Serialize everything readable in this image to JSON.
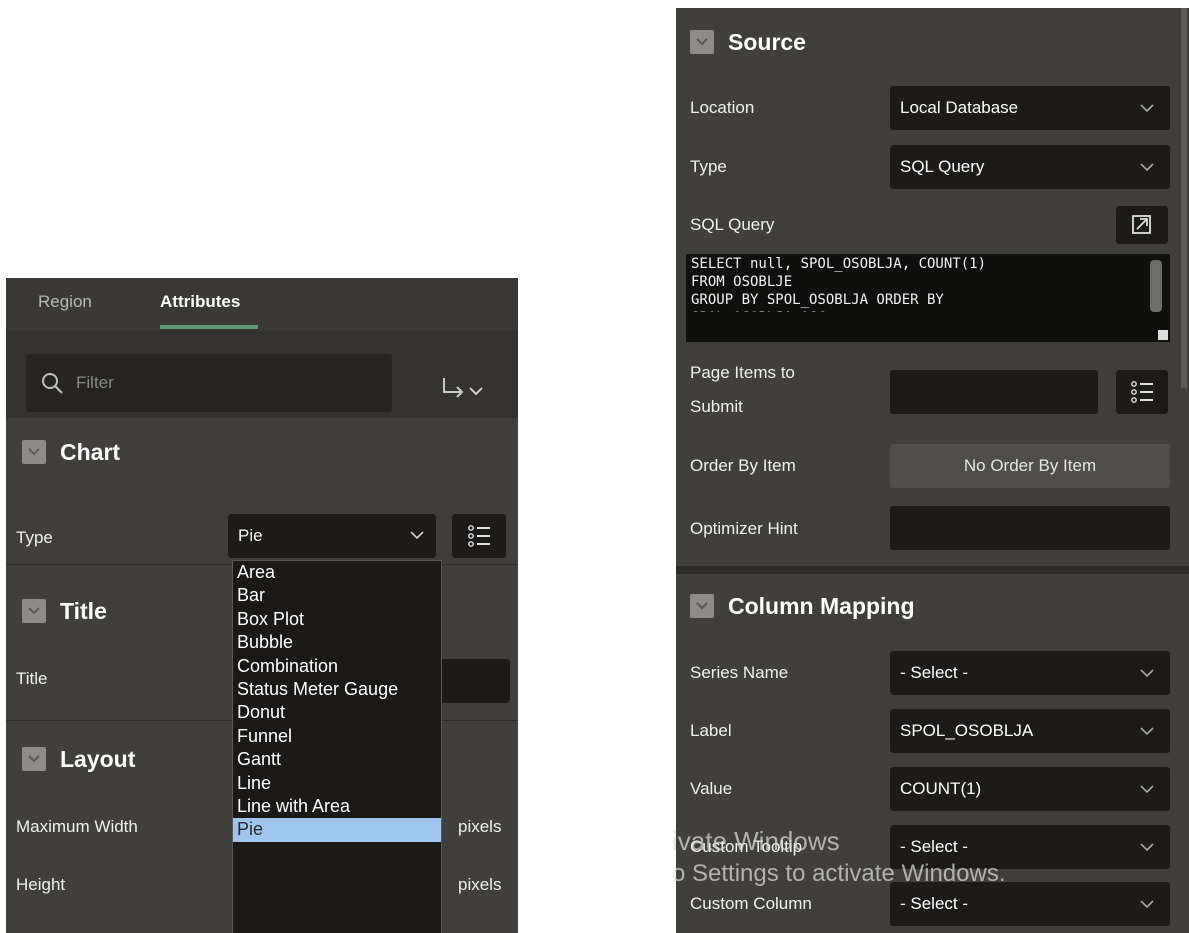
{
  "left_panel": {
    "tabs": {
      "region": "Region",
      "attributes": "Attributes"
    },
    "filter": {
      "placeholder": "Filter"
    },
    "chart": {
      "heading": "Chart",
      "type_label": "Type",
      "type_value": "Pie",
      "type_options": [
        "Area",
        "Bar",
        "Box Plot",
        "Bubble",
        "Combination",
        "Status Meter Gauge",
        "Donut",
        "Funnel",
        "Gantt",
        "Line",
        "Line with Area",
        "Pie"
      ]
    },
    "title_section": {
      "heading": "Title",
      "title_label": "Title"
    },
    "layout": {
      "heading": "Layout",
      "max_width_label": "Maximum Width",
      "height_label": "Height",
      "unit": "pixels"
    }
  },
  "right_panel": {
    "source": {
      "heading": "Source",
      "location_label": "Location",
      "location_value": "Local Database",
      "type_label": "Type",
      "type_value": "SQL Query",
      "sql_query_label": "SQL Query",
      "sql_lines": [
        "SELECT null, SPOL_OSOBLJA, COUNT(1)",
        "FROM OSOBLJE",
        "GROUP BY SPOL_OSOBLJA ORDER BY",
        "SPOL_OSOBLJA ASC"
      ],
      "page_items_label_1": "Page Items to",
      "page_items_label_2": "Submit",
      "order_by_label": "Order By Item",
      "order_by_value": "No Order By Item",
      "optimizer_label": "Optimizer Hint"
    },
    "column_mapping": {
      "heading": "Column Mapping",
      "series_name_label": "Series Name",
      "series_name_value": "- Select -",
      "label_label": "Label",
      "label_value": "SPOL_OSOBLJA",
      "value_label": "Value",
      "value_value": "COUNT(1)",
      "custom_tooltip_label": "Custom Tooltip",
      "custom_tooltip_value": "- Select -",
      "custom_column_label": "Custom Column",
      "custom_column_value": "- Select -"
    }
  },
  "watermark": {
    "line1": "ivate Windows",
    "line2": "o Settings to activate Windows."
  }
}
